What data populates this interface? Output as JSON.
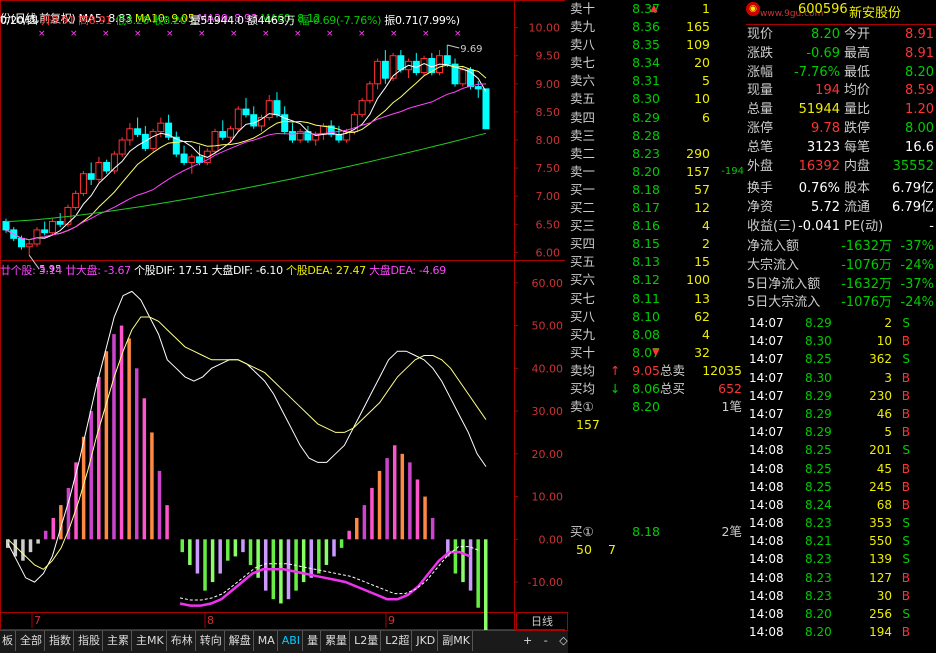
{
  "chart_header": {
    "title": "份(日线,前复权)",
    "ma5": "MA5: 8.83",
    "ma10": "MA10: 9.05",
    "ma20": "MA20: 8.93",
    "ma60": "MA60: 8.12",
    "date": "0/20/四",
    "open": "开8.91",
    "high": "高8.91",
    "low": "低8.20",
    "close": "收8.20",
    "volume": "量51944.0",
    "amount": "额4463万",
    "change": "幅-0.69(-7.76%)",
    "amplitude": "振0.71(7.99%)"
  },
  "macd_header": {
    "a": "廿个股: 3.14",
    "b": "廿大盘: -3.67",
    "dif": "个股DIF: 17.51",
    "mdif": "大盘DIF: -6.10",
    "dea": "个股DEA: 27.47",
    "mdea": "大盘DEA: -4.69"
  },
  "price_axis": [
    "10.00",
    "9.50",
    "9.00",
    "8.50",
    "8.00",
    "7.50",
    "7.00",
    "6.50",
    "6.00"
  ],
  "macd_axis": [
    "60.00",
    "50.00",
    "40.00",
    "30.00",
    "20.00",
    "10.00",
    "0.00",
    "-10.00"
  ],
  "chart_labels": {
    "hi": "9.69",
    "lo": "5.95"
  },
  "month_labels": [
    "7",
    "8",
    "9"
  ],
  "period": "日线",
  "ask_book": [
    {
      "label": "卖十",
      "price": "8.37",
      "vol": "1",
      "chg": "▲"
    },
    {
      "label": "卖九",
      "price": "8.36",
      "vol": "165",
      "chg": ""
    },
    {
      "label": "卖八",
      "price": "8.35",
      "vol": "109",
      "chg": ""
    },
    {
      "label": "卖七",
      "price": "8.34",
      "vol": "20",
      "chg": ""
    },
    {
      "label": "卖六",
      "price": "8.31",
      "vol": "5",
      "chg": ""
    },
    {
      "label": "卖五",
      "price": "8.30",
      "vol": "10",
      "chg": ""
    },
    {
      "label": "卖四",
      "price": "8.29",
      "vol": "6",
      "chg": ""
    },
    {
      "label": "卖三",
      "price": "8.28",
      "vol": "",
      "chg": ""
    },
    {
      "label": "卖二",
      "price": "8.23",
      "vol": "290",
      "chg": ""
    },
    {
      "label": "卖一",
      "price": "8.20",
      "vol": "157",
      "chg": "-194"
    }
  ],
  "bid_book": [
    {
      "label": "买一",
      "price": "8.18",
      "vol": "57"
    },
    {
      "label": "买二",
      "price": "8.17",
      "vol": "12"
    },
    {
      "label": "买三",
      "price": "8.16",
      "vol": "4"
    },
    {
      "label": "买四",
      "price": "8.15",
      "vol": "2"
    },
    {
      "label": "买五",
      "price": "8.13",
      "vol": "15"
    },
    {
      "label": "买六",
      "price": "8.12",
      "vol": "100"
    },
    {
      "label": "买七",
      "price": "8.11",
      "vol": "13"
    },
    {
      "label": "买八",
      "price": "8.10",
      "vol": "62"
    },
    {
      "label": "买九",
      "price": "8.08",
      "vol": "4"
    },
    {
      "label": "买十",
      "price": "8.07",
      "vol": "32",
      "chg": "▼"
    }
  ],
  "avg": {
    "sell_label": "卖均",
    "sell_price": "9.05",
    "sell_tot_label": "总卖",
    "sell_tot": "12035",
    "buy_label": "买均",
    "buy_price": "8.06",
    "buy_tot_label": "总买",
    "buy_tot": "652"
  },
  "queue_sell": {
    "label": "卖①",
    "price": "8.20",
    "count": "1笔",
    "vol": "157"
  },
  "queue_buy": {
    "label": "买①",
    "price": "8.18",
    "count": "2笔",
    "v1": "50",
    "v2": "7"
  },
  "stock": {
    "code": "600596",
    "name": "新安股份",
    "brand": "www.9gu.com"
  },
  "info_rows": [
    {
      "l1": "现价",
      "v1": "8.20",
      "c1": "g",
      "l2": "今开",
      "v2": "8.91",
      "c2": "r"
    },
    {
      "l1": "涨跌",
      "v1": "-0.69",
      "c1": "g",
      "l2": "最高",
      "v2": "8.91",
      "c2": "r"
    },
    {
      "l1": "涨幅",
      "v1": "-7.76%",
      "c1": "g",
      "l2": "最低",
      "v2": "8.20",
      "c2": "g"
    },
    {
      "l1": "现量",
      "v1": "194",
      "c1": "r",
      "l2": "均价",
      "v2": "8.59",
      "c2": "r"
    },
    {
      "l1": "总量",
      "v1": "51944",
      "c1": "y",
      "l2": "量比",
      "v2": "1.20",
      "c2": "r"
    },
    {
      "l1": "涨停",
      "v1": "9.78",
      "c1": "r",
      "l2": "跌停",
      "v2": "8.00",
      "c2": "g"
    },
    {
      "l1": "总笔",
      "v1": "3123",
      "c1": "w",
      "l2": "每笔",
      "v2": "16.6",
      "c2": "w"
    },
    {
      "l1": "外盘",
      "v1": "16392",
      "c1": "r",
      "l2": "内盘",
      "v2": "35552",
      "c2": "g"
    }
  ],
  "info_rows2": [
    {
      "l1": "换手",
      "v1": "0.76%",
      "c1": "w",
      "l2": "股本",
      "v2": "6.79亿",
      "c2": "w"
    },
    {
      "l1": "净资",
      "v1": "5.72",
      "c1": "w",
      "l2": "流通",
      "v2": "6.79亿",
      "c2": "w"
    },
    {
      "l1": "收益(三)",
      "v1": "-0.041",
      "c1": "w",
      "l2": "PE(动)",
      "v2": "-",
      "c2": "w"
    }
  ],
  "flow_rows": [
    {
      "l": "净流入额",
      "v": "-1632万",
      "p": "-37%"
    },
    {
      "l": "大宗流入",
      "v": "-1076万",
      "p": "-24%"
    },
    {
      "l": "5日净流入额",
      "v": "-1632万",
      "p": "-37%"
    },
    {
      "l": "5日大宗流入",
      "v": "-1076万",
      "p": "-24%"
    }
  ],
  "ticks": [
    {
      "t": "14:07",
      "p": "8.29",
      "v": "2",
      "s": "S"
    },
    {
      "t": "14:07",
      "p": "8.30",
      "v": "10",
      "s": "B"
    },
    {
      "t": "14:07",
      "p": "8.25",
      "v": "362",
      "s": "S"
    },
    {
      "t": "14:07",
      "p": "8.30",
      "v": "3",
      "s": "B"
    },
    {
      "t": "14:07",
      "p": "8.29",
      "v": "230",
      "s": "B"
    },
    {
      "t": "14:07",
      "p": "8.29",
      "v": "46",
      "s": "B"
    },
    {
      "t": "14:07",
      "p": "8.29",
      "v": "5",
      "s": "B"
    },
    {
      "t": "14:08",
      "p": "8.25",
      "v": "201",
      "s": "S"
    },
    {
      "t": "14:08",
      "p": "8.25",
      "v": "45",
      "s": "B"
    },
    {
      "t": "14:08",
      "p": "8.25",
      "v": "245",
      "s": "B"
    },
    {
      "t": "14:08",
      "p": "8.24",
      "v": "68",
      "s": "B"
    },
    {
      "t": "14:08",
      "p": "8.23",
      "v": "353",
      "s": "S"
    },
    {
      "t": "14:08",
      "p": "8.21",
      "v": "550",
      "s": "S"
    },
    {
      "t": "14:08",
      "p": "8.23",
      "v": "139",
      "s": "S"
    },
    {
      "t": "14:08",
      "p": "8.23",
      "v": "127",
      "s": "B"
    },
    {
      "t": "14:08",
      "p": "8.23",
      "v": "30",
      "s": "B"
    },
    {
      "t": "14:08",
      "p": "8.20",
      "v": "256",
      "s": "S"
    },
    {
      "t": "14:08",
      "p": "8.20",
      "v": "194",
      "s": "B"
    }
  ],
  "tabs": [
    "板",
    "全部",
    "指数",
    "指股",
    "主累",
    "主MK",
    "布林",
    "转向",
    "解盘",
    "MA",
    "ABI",
    "量",
    "累量",
    "L2量",
    "L2超",
    "JKD",
    "副MK"
  ],
  "active_tab": "ABI",
  "small_buttons": [
    "+",
    "-",
    "◇"
  ],
  "colors": {
    "up": "#ff3333",
    "down": "#00ffff",
    "ma5": "#ffffff",
    "ma10": "#ffff66",
    "ma20": "#ff44ff",
    "ma60": "#22cc22"
  },
  "chart_data": {
    "type": "candlestick",
    "ylim": [
      5.9,
      10.1
    ],
    "ohlc": [
      [
        6.55,
        6.6,
        6.35,
        6.4
      ],
      [
        6.4,
        6.45,
        6.2,
        6.25
      ],
      [
        6.25,
        6.3,
        6.05,
        6.1
      ],
      [
        6.1,
        6.2,
        5.95,
        6.15
      ],
      [
        6.15,
        6.45,
        6.1,
        6.4
      ],
      [
        6.4,
        6.55,
        6.3,
        6.35
      ],
      [
        6.35,
        6.6,
        6.3,
        6.55
      ],
      [
        6.55,
        6.7,
        6.45,
        6.5
      ],
      [
        6.5,
        6.85,
        6.45,
        6.8
      ],
      [
        6.8,
        7.1,
        6.75,
        7.05
      ],
      [
        7.05,
        7.45,
        7.0,
        7.4
      ],
      [
        7.4,
        7.6,
        7.2,
        7.3
      ],
      [
        7.3,
        7.7,
        7.25,
        7.6
      ],
      [
        7.6,
        7.65,
        7.4,
        7.45
      ],
      [
        7.45,
        7.8,
        7.4,
        7.75
      ],
      [
        7.75,
        8.05,
        7.7,
        8.0
      ],
      [
        8.0,
        8.3,
        7.9,
        8.2
      ],
      [
        8.2,
        8.4,
        8.05,
        8.1
      ],
      [
        8.1,
        8.25,
        7.8,
        7.85
      ],
      [
        7.85,
        8.2,
        7.8,
        8.15
      ],
      [
        8.15,
        8.4,
        8.05,
        8.3
      ],
      [
        8.3,
        8.45,
        8.0,
        8.05
      ],
      [
        8.05,
        8.15,
        7.7,
        7.75
      ],
      [
        7.75,
        7.9,
        7.55,
        7.6
      ],
      [
        7.6,
        7.75,
        7.4,
        7.7
      ],
      [
        7.7,
        7.9,
        7.55,
        7.6
      ],
      [
        7.6,
        7.85,
        7.55,
        7.8
      ],
      [
        7.8,
        8.2,
        7.75,
        8.15
      ],
      [
        8.15,
        8.35,
        8.0,
        8.05
      ],
      [
        8.05,
        8.25,
        7.95,
        8.2
      ],
      [
        8.2,
        8.6,
        8.15,
        8.55
      ],
      [
        8.55,
        8.75,
        8.4,
        8.45
      ],
      [
        8.45,
        8.6,
        8.2,
        8.25
      ],
      [
        8.25,
        8.45,
        8.15,
        8.4
      ],
      [
        8.4,
        8.8,
        8.35,
        8.7
      ],
      [
        8.7,
        8.85,
        8.4,
        8.45
      ],
      [
        8.45,
        8.6,
        8.1,
        8.15
      ],
      [
        8.15,
        8.3,
        7.95,
        8.0
      ],
      [
        8.0,
        8.2,
        7.95,
        8.15
      ],
      [
        8.15,
        8.25,
        7.95,
        8.0
      ],
      [
        8.0,
        8.15,
        7.9,
        8.1
      ],
      [
        8.1,
        8.3,
        8.0,
        8.25
      ],
      [
        8.25,
        8.35,
        8.05,
        8.1
      ],
      [
        8.1,
        8.25,
        7.95,
        8.0
      ],
      [
        8.0,
        8.2,
        7.95,
        8.15
      ],
      [
        8.15,
        8.5,
        8.1,
        8.45
      ],
      [
        8.45,
        8.75,
        8.4,
        8.7
      ],
      [
        8.7,
        9.05,
        8.65,
        9.0
      ],
      [
        9.0,
        9.45,
        8.9,
        9.4
      ],
      [
        9.4,
        9.6,
        9.0,
        9.1
      ],
      [
        9.1,
        9.55,
        9.05,
        9.5
      ],
      [
        9.5,
        9.6,
        9.2,
        9.25
      ],
      [
        9.25,
        9.45,
        9.1,
        9.4
      ],
      [
        9.4,
        9.55,
        9.15,
        9.2
      ],
      [
        9.2,
        9.5,
        9.15,
        9.45
      ],
      [
        9.45,
        9.55,
        9.15,
        9.2
      ],
      [
        9.2,
        9.6,
        9.15,
        9.5
      ],
      [
        9.5,
        9.69,
        9.3,
        9.35
      ],
      [
        9.35,
        9.45,
        8.95,
        9.0
      ],
      [
        9.0,
        9.3,
        8.95,
        9.25
      ],
      [
        9.25,
        9.3,
        8.9,
        8.95
      ],
      [
        8.95,
        9.05,
        8.75,
        8.91
      ],
      [
        8.91,
        8.91,
        8.2,
        8.2
      ]
    ],
    "macd_hist": [
      -2,
      -4,
      -5,
      -3,
      -1,
      2,
      5,
      8,
      12,
      18,
      24,
      30,
      38,
      44,
      48,
      50,
      47,
      40,
      33,
      25,
      16,
      8,
      0,
      -3,
      -6,
      -8,
      -12,
      -10,
      -8,
      -5,
      -4,
      -3,
      -6,
      -9,
      -12,
      -14,
      -15,
      -14,
      -12,
      -10,
      -9,
      -8,
      -6,
      -4,
      -2,
      2,
      5,
      8,
      12,
      16,
      19,
      22,
      20,
      18,
      14,
      10,
      5,
      0,
      -4,
      -8,
      -10,
      -12,
      -16,
      -26
    ],
    "dif": [
      -1,
      -5,
      -9,
      -10,
      -8,
      -4,
      3,
      10,
      18,
      27,
      36,
      44,
      52,
      57,
      58,
      56,
      52,
      48,
      42,
      40,
      38,
      37,
      38,
      40,
      41,
      42,
      42,
      41,
      39,
      37,
      34,
      30,
      26,
      22,
      19,
      18,
      18,
      20,
      22,
      26,
      30,
      34,
      38,
      42,
      44,
      44,
      43,
      42,
      40,
      37,
      33,
      29,
      25,
      20,
      17
    ],
    "dea": [
      0,
      -2,
      -4,
      -6,
      -7,
      -5,
      -2,
      3,
      9,
      16,
      24,
      31,
      38,
      44,
      49,
      52,
      52,
      51,
      49,
      47,
      45,
      44,
      43,
      42,
      42,
      42,
      42,
      41,
      40,
      39,
      37,
      35,
      33,
      31,
      29,
      27,
      26,
      25,
      25,
      26,
      28,
      30,
      32,
      35,
      38,
      40,
      42,
      43,
      43,
      42,
      40,
      37,
      34,
      31,
      28
    ],
    "market_line": [
      -15,
      -15.5,
      -15.5,
      -15,
      -14,
      -12,
      -10,
      -8,
      -7,
      -7,
      -7,
      -7.5,
      -8,
      -8.5,
      -9,
      -9.5,
      -10,
      -11,
      -12,
      -13,
      -14,
      -14,
      -13,
      -11,
      -8,
      -5,
      -3,
      -3,
      -4
    ]
  }
}
